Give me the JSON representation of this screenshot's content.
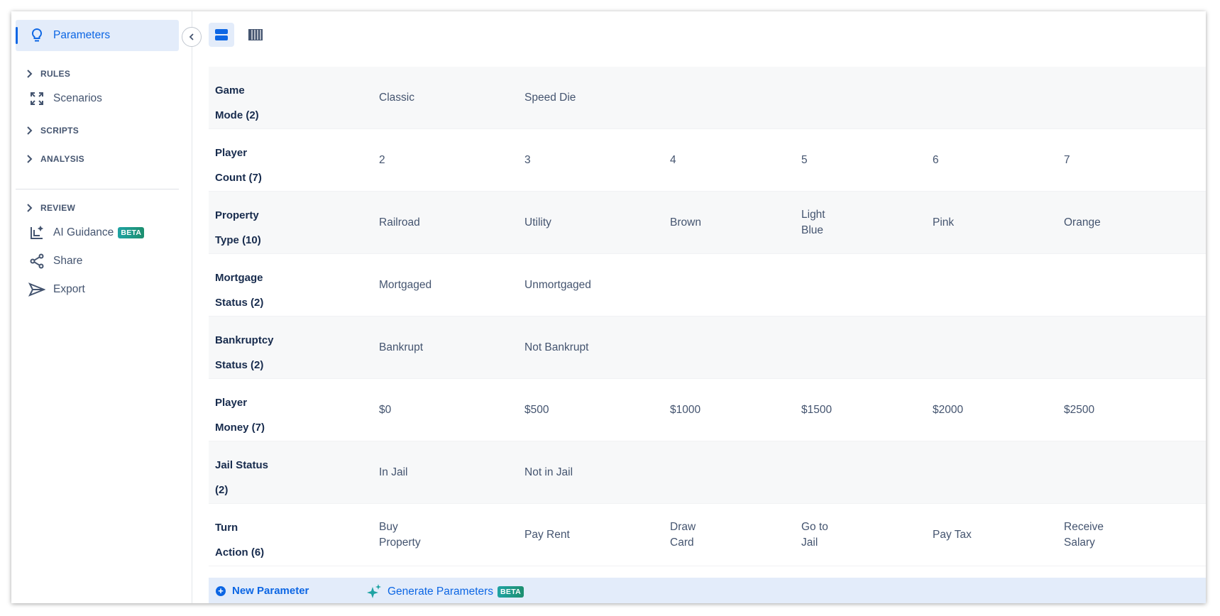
{
  "sidebar": {
    "parameters": "Parameters",
    "rules": "RULES",
    "scenarios": "Scenarios",
    "scripts": "SCRIPTS",
    "analysis": "ANALYSIS",
    "review": "REVIEW",
    "ai_guidance": "AI Guidance",
    "ai_guidance_badge": "BETA",
    "share": "Share",
    "export": "Export"
  },
  "colors": {
    "accent": "#0c66e4",
    "active_bg": "#e3ecfa",
    "beta_badge": "#1fa3a3"
  },
  "parameters": [
    {
      "name_line1": "Game",
      "name_line2": "Mode (2)",
      "values": [
        [
          "Classic"
        ],
        [
          "Speed Die"
        ]
      ]
    },
    {
      "name_line1": "Player",
      "name_line2": "Count (7)",
      "values": [
        [
          "2"
        ],
        [
          "3"
        ],
        [
          "4"
        ],
        [
          "5"
        ],
        [
          "6"
        ],
        [
          "7"
        ]
      ]
    },
    {
      "name_line1": "Property",
      "name_line2": "Type (10)",
      "values": [
        [
          "Railroad"
        ],
        [
          "Utility"
        ],
        [
          "Brown"
        ],
        [
          "Light",
          "Blue"
        ],
        [
          "Pink"
        ],
        [
          "Orange"
        ]
      ]
    },
    {
      "name_line1": "Mortgage",
      "name_line2": "Status (2)",
      "values": [
        [
          "Mortgaged"
        ],
        [
          "Unmortgaged"
        ]
      ]
    },
    {
      "name_line1": "Bankruptcy",
      "name_line2": "Status (2)",
      "values": [
        [
          "Bankrupt"
        ],
        [
          "Not Bankrupt"
        ]
      ]
    },
    {
      "name_line1": "Player",
      "name_line2": "Money (7)",
      "values": [
        [
          "$0"
        ],
        [
          "$500"
        ],
        [
          "$1000"
        ],
        [
          "$1500"
        ],
        [
          "$2000"
        ],
        [
          "$2500"
        ]
      ]
    },
    {
      "name_line1": "Jail Status",
      "name_line2": "(2)",
      "values": [
        [
          "In Jail"
        ],
        [
          "Not in Jail"
        ]
      ]
    },
    {
      "name_line1": "Turn",
      "name_line2": "Action (6)",
      "values": [
        [
          "Buy",
          "Property"
        ],
        [
          "Pay Rent"
        ],
        [
          "Draw",
          "Card"
        ],
        [
          "Go to",
          "Jail"
        ],
        [
          "Pay Tax"
        ],
        [
          "Receive",
          "Salary"
        ]
      ]
    }
  ],
  "bottom": {
    "new_parameter": "New Parameter",
    "generate_parameters": "Generate Parameters",
    "generate_badge": "BETA"
  }
}
